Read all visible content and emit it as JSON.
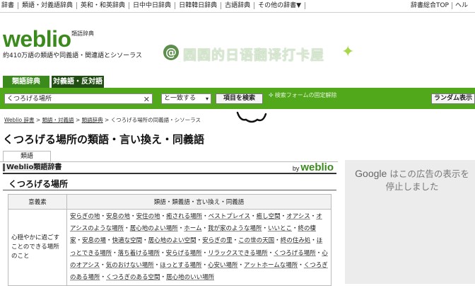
{
  "topnav": {
    "left": [
      "辞書",
      "類語・対義語辞典",
      "英和・和英辞典",
      "日中中日辞典",
      "日韓韓日辞典",
      "古語辞典",
      "その他の辞書▼"
    ],
    "right": [
      "辞書総合TOP",
      "ヘル"
    ]
  },
  "header": {
    "logo_text": "weblio",
    "logo_sub": "類語辞典",
    "tagline": "約410万語の類語や同義語・関連語とシソーラス",
    "banner_at": "@",
    "banner_text": "圆圆的日语翻译打卡屋",
    "banner_star": "✦"
  },
  "tabs": [
    "類語辞典",
    "対義語・反対語"
  ],
  "search": {
    "value": "くつろげる場所",
    "clear": "✕",
    "mode": "と一致する",
    "mode_arrow": "▾",
    "submit": "項目を検索",
    "info": "検索フォームの固定解除",
    "random": "ランダム表示"
  },
  "breadcrumb": [
    "Weblio 辞書",
    "類語・対義語",
    "類語辞典",
    "くつろげる場所の同義語・シソーラス"
  ],
  "page_title": "くつろげる場所の類語・言い換え・同義語",
  "subtab": "類語",
  "dict": {
    "label": "Weblio類語辞書",
    "by": "by",
    "brand": "weblio"
  },
  "entry": "くつろげる場所",
  "table": {
    "headers": [
      "意義素",
      "類語・類義語・言い換え・同義語"
    ],
    "sense": "心穏やかに過ごすことのできる場所のこと",
    "words": [
      "安らぎの地",
      "安息の地",
      "安住の地",
      "癒される場所",
      "ベストプレイス",
      "癒し空間",
      "オアシス",
      "オアシスのような場所",
      "居心地のよい場所",
      "ホーム",
      "我が家のような場所",
      "いいとこ",
      "終の棲家",
      "安息の場",
      "快適な空間",
      "居心地のよい空間",
      "安らぎの里",
      "この世の天国",
      "終の住み処",
      "ほっとできる場所",
      "落ち着ける場所",
      "安らげる場所",
      "リラックスできる場所",
      "くつろげる場所",
      "心のオアシス",
      "気のおけない場所",
      "ほっとする場所",
      "心安い場所",
      "アットホームな場所",
      "くつろぎのある場所",
      "くつろぎのある空間",
      "居心地のいい場所"
    ]
  },
  "ad": {
    "brand": "Google",
    "message": "はこの広告の表示を停止しました"
  }
}
